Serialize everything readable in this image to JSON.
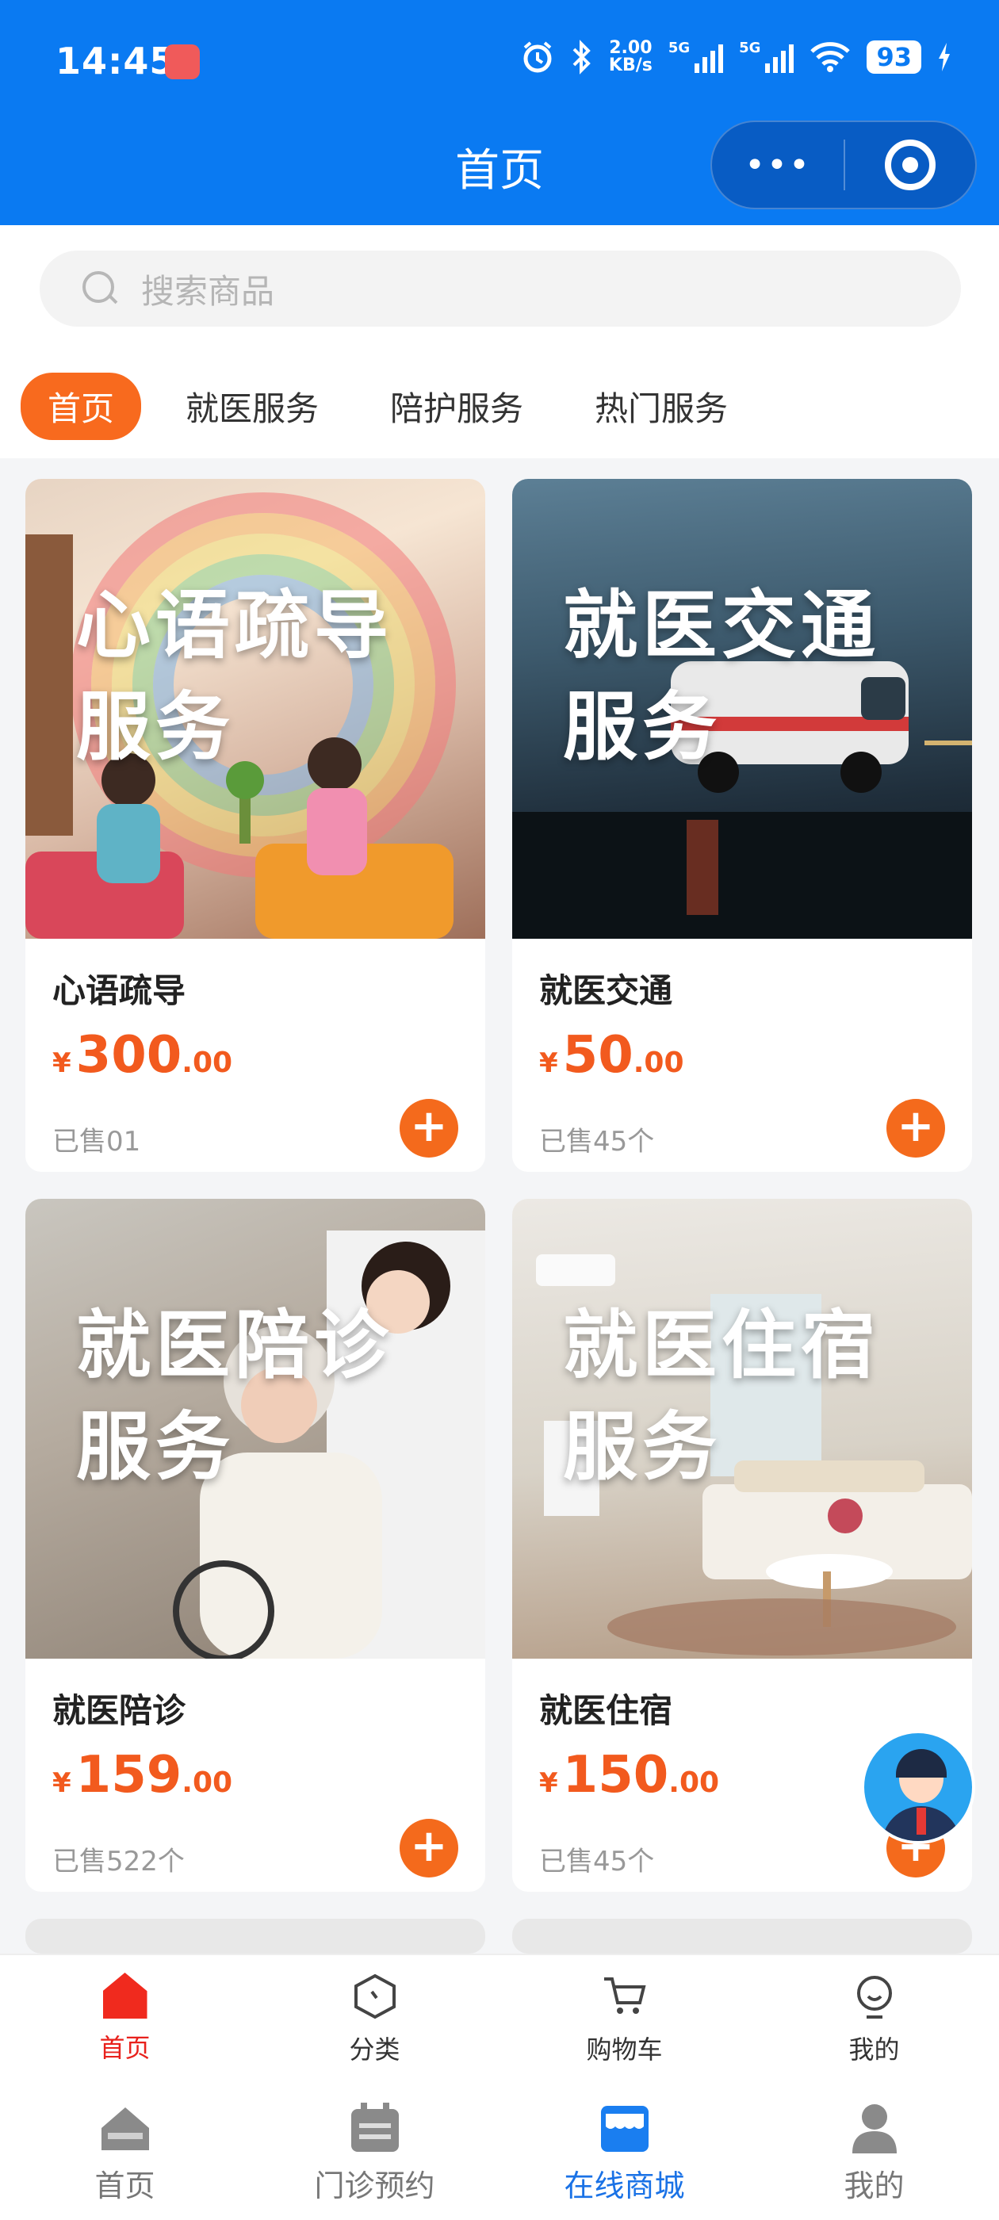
{
  "status_bar": {
    "time": "14:45",
    "net_speed_value": "2.00",
    "net_speed_unit": "KB/s",
    "sig1": "5G",
    "sig2": "5G",
    "battery": "93"
  },
  "header": {
    "title": "首页",
    "more_label": "•••"
  },
  "search": {
    "placeholder": "搜索商品"
  },
  "tabs": [
    {
      "label": "首页",
      "active": true
    },
    {
      "label": "就医服务"
    },
    {
      "label": "陪护服务"
    },
    {
      "label": "热门服务"
    }
  ],
  "products": [
    {
      "image_line1": "心语疏导",
      "image_line2": "服务",
      "name": "心语疏导",
      "currency": "¥",
      "price_int": "300",
      "price_dec": ".00",
      "sold": "已售01",
      "add_label": "+"
    },
    {
      "image_line1": "就医交通",
      "image_line2": "服务",
      "name": "就医交通",
      "currency": "¥",
      "price_int": "50",
      "price_dec": ".00",
      "sold": "已售45个",
      "add_label": "+"
    },
    {
      "image_line1": "就医陪诊",
      "image_line2": "服务",
      "name": "就医陪诊",
      "currency": "¥",
      "price_int": "159",
      "price_dec": ".00",
      "sold": "已售522个",
      "add_label": "+"
    },
    {
      "image_line1": "就医住宿",
      "image_line2": "服务",
      "name": "就医住宿",
      "currency": "¥",
      "price_int": "150",
      "price_dec": ".00",
      "sold": "已售45个",
      "add_label": "+"
    }
  ],
  "inner_tabbar": [
    {
      "label": "首页",
      "icon": "home-icon",
      "active": true
    },
    {
      "label": "分类",
      "icon": "category-icon"
    },
    {
      "label": "购物车",
      "icon": "cart-icon"
    },
    {
      "label": "我的",
      "icon": "profile-icon"
    }
  ],
  "outer_tabbar": [
    {
      "label": "首页",
      "icon": "home-icon"
    },
    {
      "label": "门诊预约",
      "icon": "calendar-icon"
    },
    {
      "label": "在线商城",
      "icon": "store-icon",
      "active": true
    },
    {
      "label": "我的",
      "icon": "user-icon"
    }
  ],
  "colors": {
    "header_blue": "#0a7af2",
    "accent_orange": "#f46a1c",
    "active_red": "#e8211c",
    "active_blue": "#1a72e6"
  }
}
